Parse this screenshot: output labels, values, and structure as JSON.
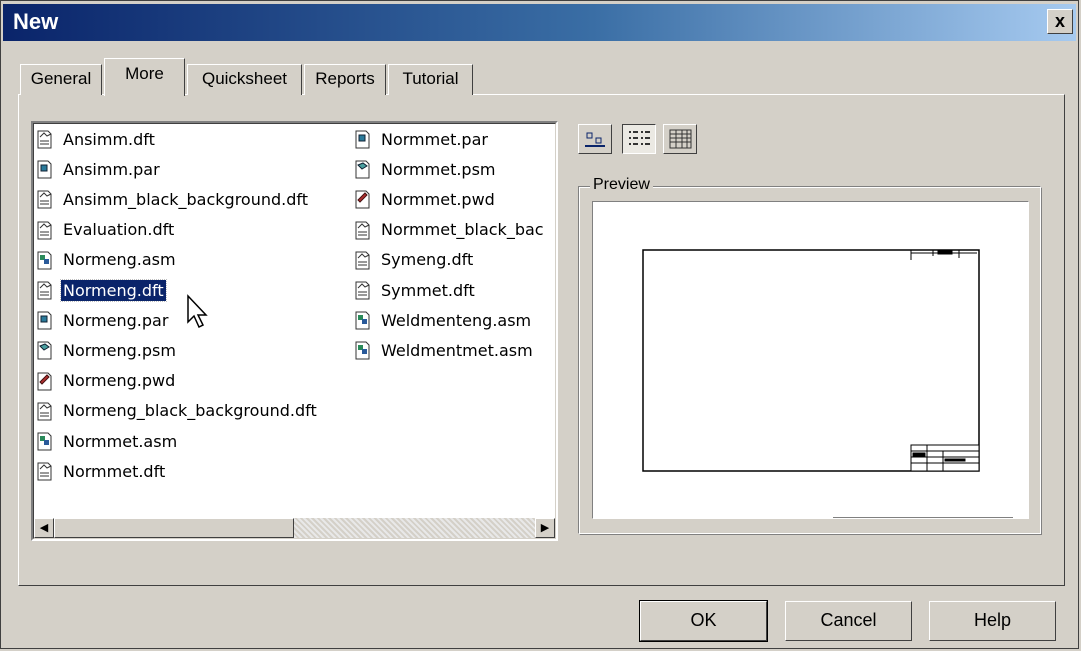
{
  "window": {
    "title": "New",
    "close_label": "x"
  },
  "tabs": [
    {
      "label": "General",
      "active": false
    },
    {
      "label": "More",
      "active": true
    },
    {
      "label": "Quicksheet",
      "active": false
    },
    {
      "label": "Reports",
      "active": false
    },
    {
      "label": "Tutorial",
      "active": false
    }
  ],
  "files": [
    {
      "name": "Ansimm.dft",
      "type": "dft"
    },
    {
      "name": "Ansimm.par",
      "type": "par"
    },
    {
      "name": "Ansimm_black_background.dft",
      "type": "dft"
    },
    {
      "name": "Evaluation.dft",
      "type": "dft"
    },
    {
      "name": "Normeng.asm",
      "type": "asm"
    },
    {
      "name": "Normeng.dft",
      "type": "dft",
      "selected": true
    },
    {
      "name": "Normeng.par",
      "type": "par"
    },
    {
      "name": "Normeng.psm",
      "type": "psm"
    },
    {
      "name": "Normeng.pwd",
      "type": "pwd"
    },
    {
      "name": "Normeng_black_background.dft",
      "type": "dft"
    },
    {
      "name": "Normmet.asm",
      "type": "asm"
    },
    {
      "name": "Normmet.dft",
      "type": "dft"
    },
    {
      "name": "Normmet.par",
      "type": "par"
    },
    {
      "name": "Normmet.psm",
      "type": "psm"
    },
    {
      "name": "Normmet.pwd",
      "type": "pwd"
    },
    {
      "name": "Normmet_black_bac",
      "type": "dft"
    },
    {
      "name": "Symeng.dft",
      "type": "dft"
    },
    {
      "name": "Symmet.dft",
      "type": "dft"
    },
    {
      "name": "Weldmenteng.asm",
      "type": "asm"
    },
    {
      "name": "Weldmentmet.asm",
      "type": "asm"
    }
  ],
  "view_buttons": [
    {
      "icon": "large-icons-view-icon",
      "pressed": false
    },
    {
      "icon": "list-view-icon",
      "pressed": true
    },
    {
      "icon": "details-view-icon",
      "pressed": false
    }
  ],
  "preview": {
    "label": "Preview"
  },
  "buttons": {
    "ok": "OK",
    "cancel": "Cancel",
    "help": "Help"
  }
}
